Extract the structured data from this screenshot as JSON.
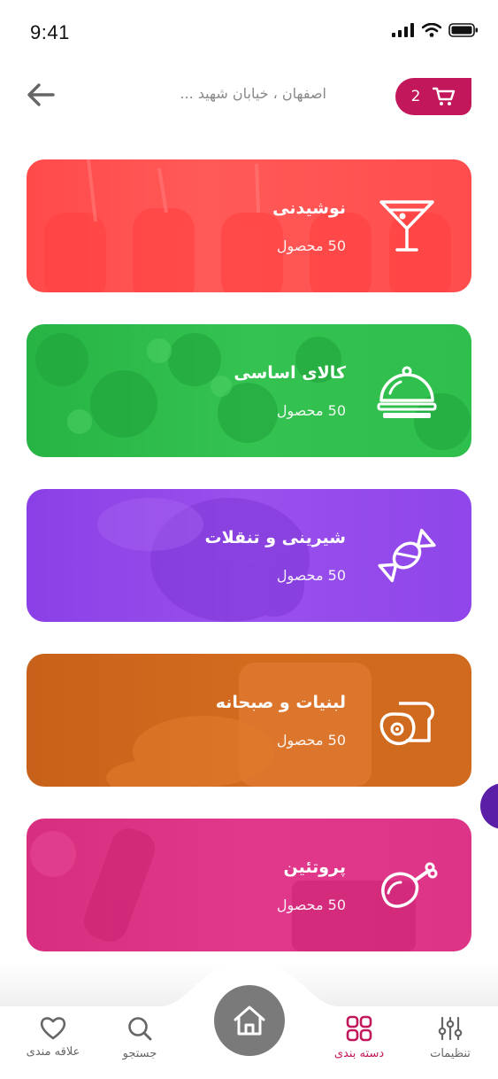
{
  "status_bar": {
    "time": "9:41"
  },
  "header": {
    "address": "اصفهان ، خیابان شهید ...",
    "cart_count": "2"
  },
  "categories": [
    {
      "title": "نوشیدنی",
      "count": "50 محصول",
      "icon": "cocktail-icon",
      "color": "#ff5252"
    },
    {
      "title": "کالای اساسی",
      "count": "50 محصول",
      "icon": "cloche-icon",
      "color": "#2ebd4e"
    },
    {
      "title": "شیرینی و تنقلات",
      "count": "50 محصول",
      "icon": "candy-icon",
      "color": "#8e44e8"
    },
    {
      "title": "لبنیات و صبحانه",
      "count": "50 محصول",
      "icon": "breakfast-icon",
      "color": "#d2691e"
    },
    {
      "title": "پروتئین",
      "count": "50 محصول",
      "icon": "chicken-leg-icon",
      "color": "#e0338a"
    }
  ],
  "bottom_nav": {
    "items": [
      {
        "label": "تنظیمات",
        "icon": "sliders-icon"
      },
      {
        "label": "دسته بندی",
        "icon": "grid-icon",
        "active": true
      },
      {
        "label": "",
        "icon": "home-icon"
      },
      {
        "label": "جستجو",
        "icon": "search-icon"
      },
      {
        "label": "علاقه مندی",
        "icon": "heart-icon"
      }
    ]
  },
  "colors": {
    "accent": "#c2185b",
    "home_button": "#7a7a7a",
    "side_tab": "#5b1ea6"
  }
}
